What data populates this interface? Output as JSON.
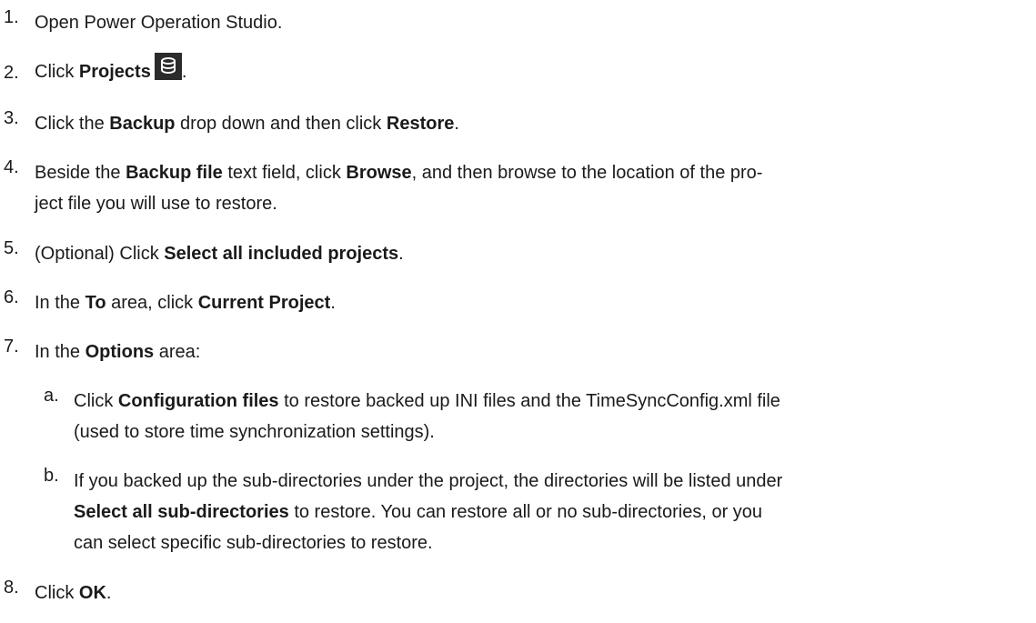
{
  "steps": [
    {
      "num": "1.",
      "parts": [
        "Open Power Operation Studio."
      ]
    },
    {
      "num": "2.",
      "pre": "Click ",
      "b1": "Projects",
      "post": ".",
      "icon": "database-icon"
    },
    {
      "num": "3.",
      "pre": "Click the ",
      "b1": "Backup",
      "mid1": " drop down and then click ",
      "b2": "Restore",
      "post": "."
    },
    {
      "num": "4.",
      "pre": "Beside the ",
      "b1": "Backup file",
      "mid1": " text field, click ",
      "b2": "Browse",
      "post_line1": ", and then browse to the location of the pro-",
      "line2": "ject file you will use to restore."
    },
    {
      "num": "5.",
      "pre": "(Optional) Click ",
      "b1": "Select all included projects",
      "post": "."
    },
    {
      "num": "6.",
      "pre": "In the ",
      "b1": "To",
      "mid1": " area, click ",
      "b2": "Current Project",
      "post": "."
    },
    {
      "num": "7.",
      "pre": "In the ",
      "b1": "Options",
      "post": " area:"
    },
    {
      "num": "8.",
      "pre": "Click ",
      "b1": "OK",
      "post": "."
    }
  ],
  "substeps": [
    {
      "num": "a.",
      "pre": "Click ",
      "b1": "Configuration files",
      "post_line1": " to restore backed up INI files and the TimeSyncConfig.xml file",
      "line2": "(used to store time synchronization settings)."
    },
    {
      "num": "b.",
      "line1": "If you backed up the sub-directories under the project, the directories will be listed under",
      "b1": "Select all sub-directories",
      "post_line2": " to restore. You can restore all or no sub-directories, or you",
      "line3": "can select specific sub-directories to restore."
    }
  ]
}
